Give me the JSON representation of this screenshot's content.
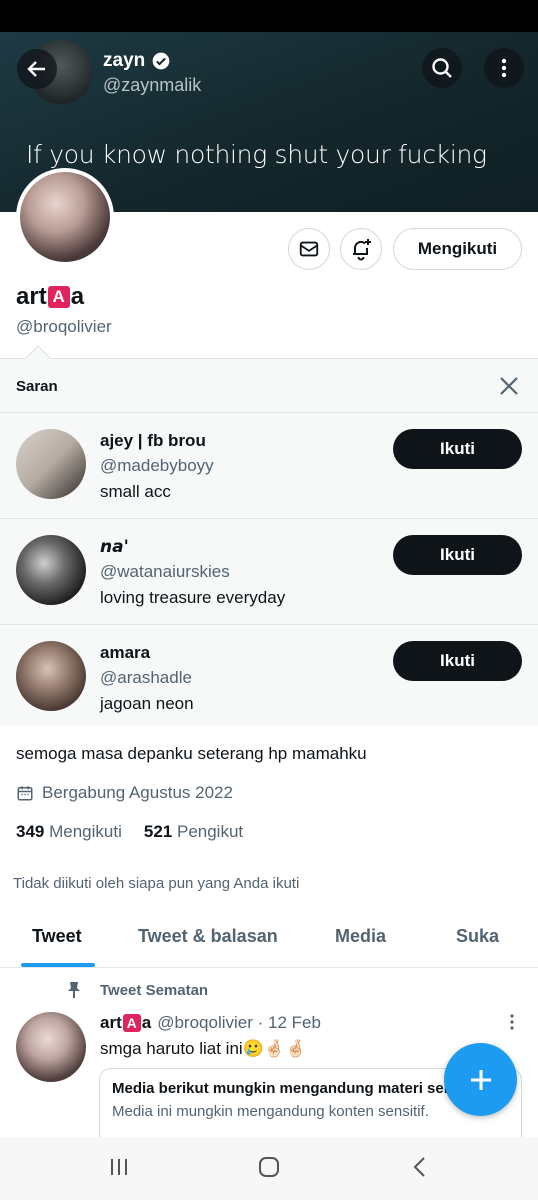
{
  "header": {
    "name": "zayn",
    "handle": "@zaynmalik",
    "banner_text": "If you know nothing shut your fucking"
  },
  "profile": {
    "display_name_prefix": "art",
    "display_name_badge": "A",
    "display_name_suffix": "a",
    "handle": "@broqolivier",
    "following_button": "Mengikuti",
    "bio": "semoga masa depanku seterang hp mamahku",
    "joined": "Bergabung Agustus 2022",
    "following_count": "349",
    "following_label": "Mengikuti",
    "followers_count": "521",
    "followers_label": "Pengikut",
    "followed_by": "Tidak diikuti oleh siapa pun yang Anda ikuti"
  },
  "suggestions": {
    "title": "Saran",
    "items": [
      {
        "name": "ajey | fb brou",
        "handle": "@madebyboyy",
        "bio": "small acc",
        "button": "Ikuti"
      },
      {
        "name": "𝙣𝙖'",
        "handle": "@watanaiurskies",
        "bio": "loving treasure everyday",
        "button": "Ikuti"
      },
      {
        "name": "amara",
        "handle": "@arashadle",
        "bio": "jagoan neon",
        "button": "Ikuti"
      }
    ]
  },
  "tabs": [
    "Tweet",
    "Tweet & balasan",
    "Media",
    "Suka"
  ],
  "pinned_tweet": {
    "label": "Tweet Sematan",
    "name_prefix": "art",
    "name_badge": "A",
    "name_suffix": "a",
    "handle_date": "@broqolivier · 12 Feb",
    "text": "smga haruto liat ini🥲🤞🏻🤞🏻",
    "sensitive_title": "Media berikut mungkin mengandung materi sensitif.",
    "sensitive_desc": "Media ini mungkin mengandung konten sensitif."
  },
  "colors": {
    "accent": "#1d9bf0",
    "badge_red": "#e0245e",
    "text_primary": "#0f1419",
    "text_secondary": "#536471"
  }
}
